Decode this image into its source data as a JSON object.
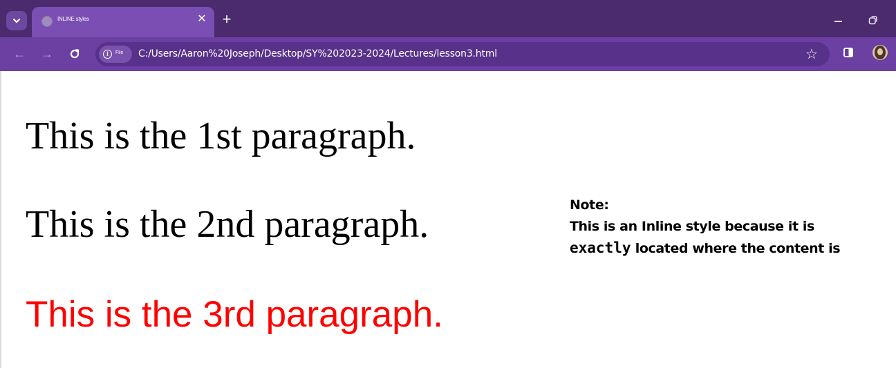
{
  "browser": {
    "tab": {
      "title": "INLINE styles"
    },
    "url": "C:/Users/Aaron%20Joseph/Desktop/SY%202023-2024/Lectures/lesson3.html",
    "site_chip_label": "File",
    "icons": {
      "tab_menu": "chevron-down-icon",
      "close": "close-icon",
      "new_tab": "plus-icon",
      "back": "arrow-left-icon",
      "forward": "arrow-right-icon",
      "reload": "reload-icon",
      "info": "info-icon",
      "bookmark": "star-icon",
      "side_panel": "side-panel-icon",
      "minimize": "minimize-icon",
      "restore": "restore-icon"
    },
    "colors": {
      "tabbar_bg": "#4b2a6e",
      "toolbar_bg": "#6c3fa3",
      "active_tab_bg": "#7a4eb3"
    }
  },
  "page": {
    "paragraphs": [
      {
        "text": "This is the 1st paragraph.",
        "color": "#000000"
      },
      {
        "text": "This is the 2nd paragraph.",
        "color": "#000000"
      },
      {
        "text": "This is the 3rd paragraph.",
        "color": "#ff0000"
      }
    ],
    "note": {
      "heading": "Note:",
      "line_prefix": "This is an Inline style because it is",
      "code_word": "exactly",
      "line_suffix": "located where the content is"
    }
  }
}
